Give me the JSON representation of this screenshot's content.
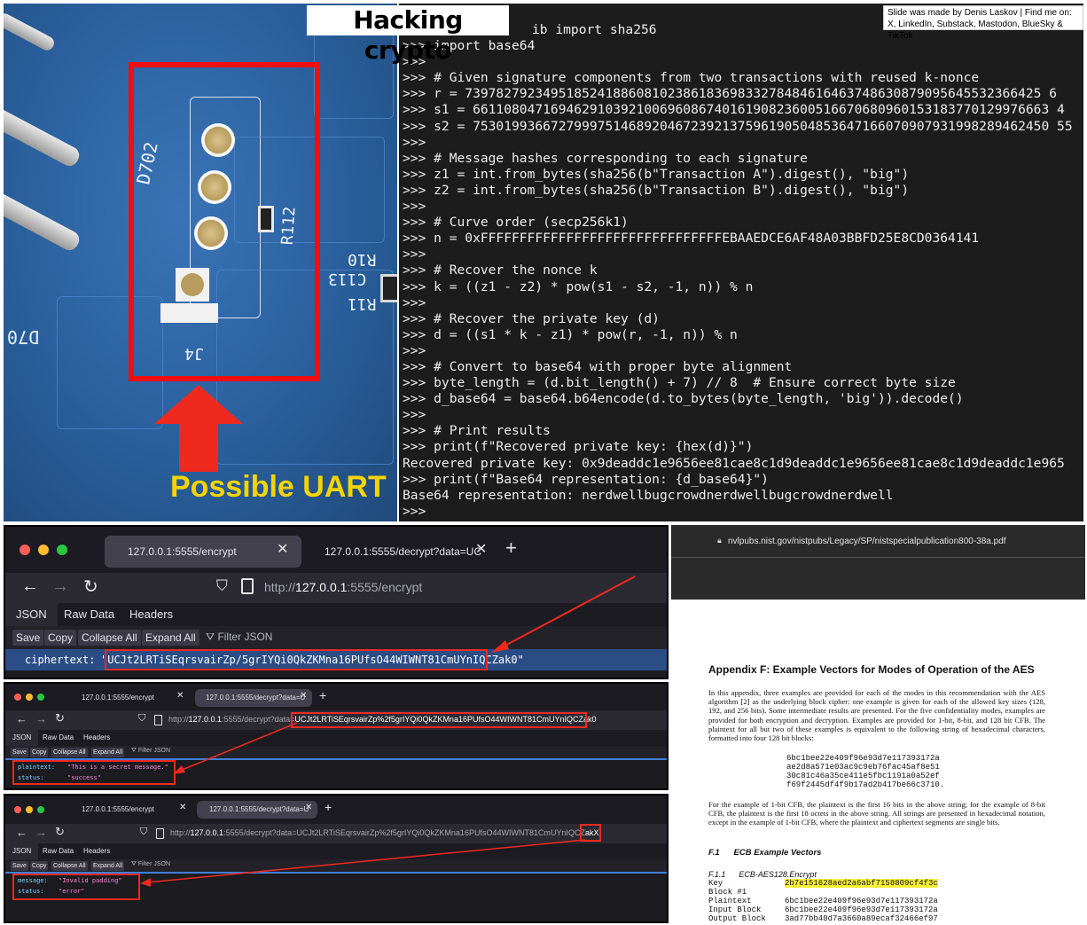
{
  "slide": {
    "title": "Hacking crypto",
    "credit_line1": "Slide was made by Denis Laskov | Find me on:",
    "credit_line2": "X, LinkedIn, Substack, Mastodon, BlueSky & TikTok"
  },
  "pcb": {
    "silkscreen": [
      "D702",
      "R112",
      "R10",
      "C113",
      "R11",
      "J4",
      "D70"
    ],
    "callout": "Possible UART"
  },
  "terminal": {
    "lines": [
      "ib import sha256",
      ">>> import base64",
      ">>>",
      ">>> # Given signature components from two transactions with reused k-nonce",
      ">>> r = 73978279234951852418860810238618369833278484616463748630879095645532366425 6",
      ">>> s1 = 66110804716946291039210069608674016190823600516670680960153183770129976663 4",
      ">>> s2 = 75301993667279997514689204672392137596190504853647166070907931998289462450 55",
      ">>>",
      ">>> # Message hashes corresponding to each signature",
      ">>> z1 = int.from_bytes(sha256(b\"Transaction A\").digest(), \"big\")",
      ">>> z2 = int.from_bytes(sha256(b\"Transaction B\").digest(), \"big\")",
      ">>>",
      ">>> # Curve order (secp256k1)",
      ">>> n = 0xFFFFFFFFFFFFFFFFFFFFFFFFFFFFFFFEBAAEDCE6AF48A03BBFD25E8CD0364141",
      ">>>",
      ">>> # Recover the nonce k",
      ">>> k = ((z1 - z2) * pow(s1 - s2, -1, n)) % n",
      ">>>",
      ">>> # Recover the private key (d)",
      ">>> d = ((s1 * k - z1) * pow(r, -1, n)) % n",
      ">>>",
      ">>> # Convert to base64 with proper byte alignment",
      ">>> byte_length = (d.bit_length() + 7) // 8  # Ensure correct byte size",
      ">>> d_base64 = base64.b64encode(d.to_bytes(byte_length, 'big')).decode()",
      ">>>",
      ">>> # Print results",
      ">>> print(f\"Recovered private key: {hex(d)}\")",
      "Recovered private key: 0x9deaddc1e9656ee81cae8c1d9deaddc1e9656ee81cae8c1d9deaddc1e965",
      ">>> print(f\"Base64 representation: {d_base64}\")",
      "Base64 representation: nerdwellbugcrowdnerdwellbugcrowdnerdwell",
      ">>>"
    ]
  },
  "browser1": {
    "tab1": "127.0.0.1:5555/encrypt",
    "tab2": "127.0.0.1:5555/decrypt?data=UC",
    "url_host": "127.0.0.1",
    "url_prefix": "http://",
    "url_path": ":5555/encrypt",
    "json_tabs": [
      "JSON",
      "Raw Data",
      "Headers"
    ],
    "toolbar": [
      "Save",
      "Copy",
      "Collapse All",
      "Expand All"
    ],
    "filter": "Filter JSON",
    "rows": [
      {
        "key": "ciphertext:",
        "value": "\"UCJt2LRTiSEqrsvairZp/5grIYQi0QkZKMna16PUfsO44WIWNT81CmUYnIQCZak0\""
      }
    ]
  },
  "browser2": {
    "tab1": "127.0.0.1:5555/encrypt",
    "tab2": "127.0.0.1:5555/decrypt?data=U",
    "url_prefix": "http://",
    "url_host": "127.0.0.1",
    "url_path": ":5555/decrypt?data=",
    "url_param": "UCJt2LRTiSEqrsvairZp%2f5grIYQi0QkZKMna16PUfsO44WIWNT81CmUYnIQCZak0",
    "json_tabs": [
      "JSON",
      "Raw Data",
      "Headers"
    ],
    "toolbar": [
      "Save",
      "Copy",
      "Collapse All",
      "Expand All"
    ],
    "filter": "Filter JSON",
    "rows": [
      {
        "key": "plaintext:",
        "value": "\"This is a secret message.\""
      },
      {
        "key": "status:",
        "value": "\"success\""
      }
    ]
  },
  "browser3": {
    "tab1": "127.0.0.1:5555/encrypt",
    "tab2": "127.0.0.1:5555/decrypt?data=U",
    "url_prefix": "http://",
    "url_host": "127.0.0.1",
    "url_path": ":5555/decrypt?data=UCJt2LRTiSEqrsvairZp%2f5grIYQi0QkZKMna16PUfsO44WIWNT81CmUYnIQCZ",
    "url_tail": "akX",
    "json_tabs": [
      "JSON",
      "Raw Data",
      "Headers"
    ],
    "toolbar": [
      "Save",
      "Copy",
      "Collapse All",
      "Expand All"
    ],
    "filter": "Filter JSON",
    "rows": [
      {
        "key": "message:",
        "value": "\"Invalid padding\""
      },
      {
        "key": "status:",
        "value": "\"error\""
      }
    ]
  },
  "pdf": {
    "url": "nvlpubs.nist.gov/nistpubs/Legacy/SP/nistspecialpublication800-38a.pdf",
    "heading": "Appendix F:  Example Vectors for Modes of Operation of the AES",
    "para1": "In this appendix, three examples are provided for each of the modes in this recommendation with the AES algorithm [2] as the underlying block cipher: one example is given for each of the allowed key sizes (128, 192, and 256 bits). Some intermediate results are presented. For the five confidentiality modes, examples are provided for both encryption and decryption. Examples are provided for 1-bit, 8-bit, and 128 bit CFB. The plaintext for all but two of these examples is equivalent to the following string of hexadecimal characters, formatted into four 128 bit blocks:",
    "hex_blocks": [
      "6bc1bee22e409f96e93d7e117393172a",
      "ae2d8a571e03ac9c9eb76fac45af8e51",
      "30c81c46a35ce411e5fbc1191a0a52ef",
      "f69f2445df4f9b17ad2b417be66c3710."
    ],
    "para2": "For the example of 1-bit CFB, the plaintext is the first 16 bits in the above string; for the example of 8-bit CFB, the plaintext is the first 18 octets in the above string.  All strings are presented in hexadecimal notation, except in the example of 1-bit CFB, where the plaintext and ciphertext segments are single bits.",
    "section": "F.1      ECB Example Vectors",
    "subsection": "F.1.1      ECB-AES128.Encrypt",
    "key_label": "Key",
    "key_value": "2b7e151628aed2a6abf7158809cf4f3c",
    "block_label": "Block #1",
    "plain_label": "Plaintext",
    "plain_value": "6bc1bee22e409f96e93d7e117393172a",
    "input_label": "Input Block",
    "input_value": "6bc1bee22e409f96e93d7e117393172a",
    "output_label": "Output Block",
    "output_value": "3ad77bb40d7a3660a89ecaf32466ef97"
  }
}
